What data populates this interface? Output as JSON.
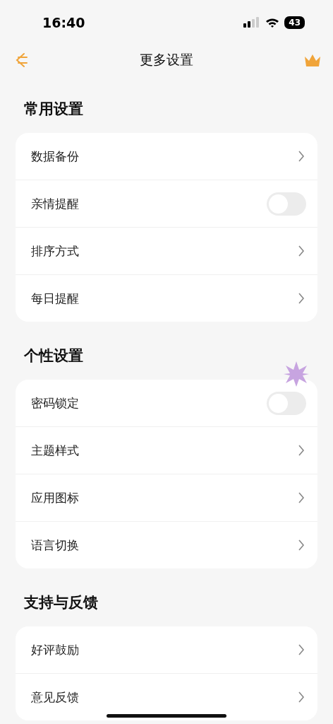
{
  "status_bar": {
    "time": "16:40",
    "battery": "43"
  },
  "nav": {
    "title": "更多设置"
  },
  "sections": [
    {
      "title": "常用设置",
      "rows": [
        {
          "label": "数据备份",
          "kind": "link"
        },
        {
          "label": "亲情提醒",
          "kind": "toggle",
          "on": false
        },
        {
          "label": "排序方式",
          "kind": "link"
        },
        {
          "label": "每日提醒",
          "kind": "link"
        }
      ]
    },
    {
      "title": "个性设置",
      "rows": [
        {
          "label": "密码锁定",
          "kind": "toggle",
          "on": false
        },
        {
          "label": "主题样式",
          "kind": "link"
        },
        {
          "label": "应用图标",
          "kind": "link"
        },
        {
          "label": "语言切换",
          "kind": "link"
        }
      ]
    },
    {
      "title": "支持与反馈",
      "rows": [
        {
          "label": "好评鼓励",
          "kind": "link"
        },
        {
          "label": "意见反馈",
          "kind": "link"
        }
      ]
    }
  ]
}
